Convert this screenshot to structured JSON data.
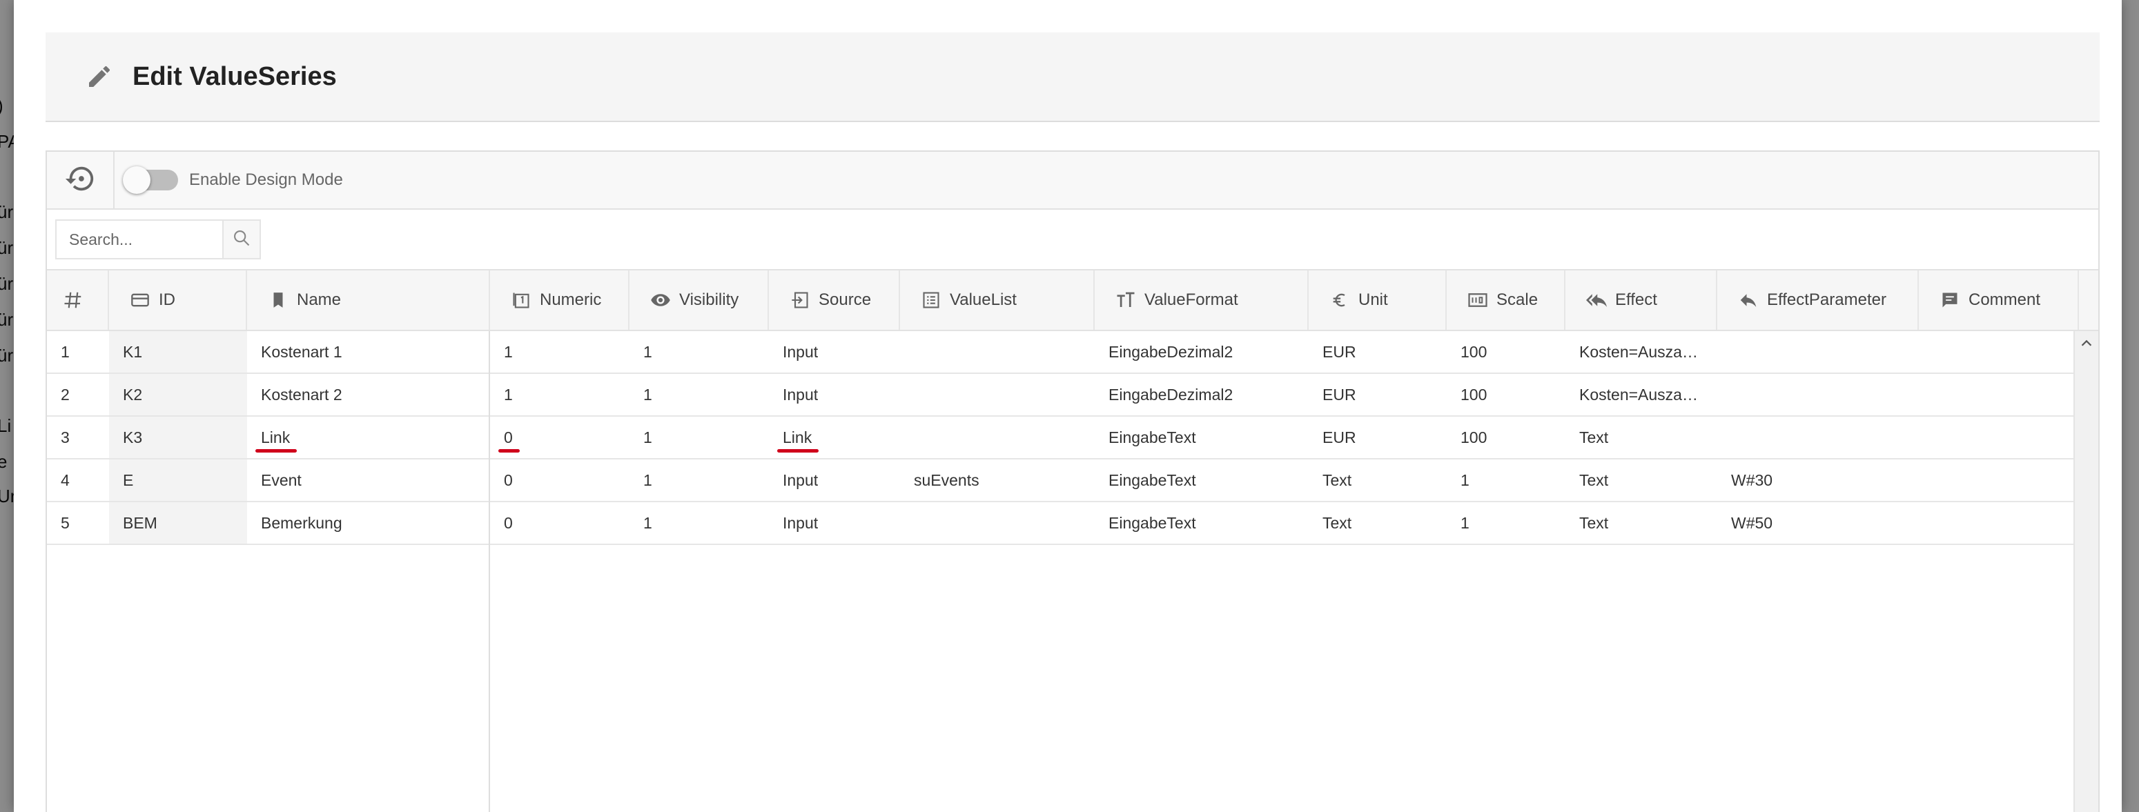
{
  "background_fragments": [
    ")",
    "PA",
    "ür",
    "ür",
    "ür",
    "ür",
    "ür",
    "Li",
    "e",
    "Ur"
  ],
  "modal": {
    "title": "Edit ValueSeries"
  },
  "toolbar": {
    "design_mode_label": "Enable Design Mode",
    "design_mode_enabled": false
  },
  "search": {
    "placeholder": "Search..."
  },
  "table": {
    "columns": [
      {
        "key": "num",
        "label": "#",
        "icon": "hash-icon"
      },
      {
        "key": "id",
        "label": "ID",
        "icon": "card-icon"
      },
      {
        "key": "name",
        "label": "Name",
        "icon": "bookmark-icon"
      },
      {
        "key": "numeric",
        "label": "Numeric",
        "icon": "numeric-box-icon"
      },
      {
        "key": "visibility",
        "label": "Visibility",
        "icon": "eye-icon"
      },
      {
        "key": "source",
        "label": "Source",
        "icon": "login-icon"
      },
      {
        "key": "valuelist",
        "label": "ValueList",
        "icon": "list-icon"
      },
      {
        "key": "valueformat",
        "label": "ValueFormat",
        "icon": "text-size-icon"
      },
      {
        "key": "unit",
        "label": "Unit",
        "icon": "euro-icon"
      },
      {
        "key": "scale",
        "label": "Scale",
        "icon": "counter-icon"
      },
      {
        "key": "effect",
        "label": "Effect",
        "icon": "reply-all-icon"
      },
      {
        "key": "effectparameter",
        "label": "EffectParameter",
        "icon": "reply-icon"
      },
      {
        "key": "comment",
        "label": "Comment",
        "icon": "comment-icon"
      }
    ],
    "rows": [
      {
        "num": "1",
        "id": "K1",
        "name": "Kostenart 1",
        "numeric": "1",
        "visibility": "1",
        "source": "Input",
        "valuelist": "",
        "valueformat": "EingabeDezimal2",
        "unit": "EUR",
        "scale": "100",
        "effect": "Kosten=Ausza…",
        "effectparameter": "",
        "comment": ""
      },
      {
        "num": "2",
        "id": "K2",
        "name": "Kostenart 2",
        "numeric": "1",
        "visibility": "1",
        "source": "Input",
        "valuelist": "",
        "valueformat": "EingabeDezimal2",
        "unit": "EUR",
        "scale": "100",
        "effect": "Kosten=Ausza…",
        "effectparameter": "",
        "comment": ""
      },
      {
        "num": "3",
        "id": "K3",
        "name": "Link",
        "numeric": "0",
        "visibility": "1",
        "source": "Link",
        "valuelist": "",
        "valueformat": "EingabeText",
        "unit": "EUR",
        "scale": "100",
        "effect": "Text",
        "effectparameter": "",
        "comment": ""
      },
      {
        "num": "4",
        "id": "E",
        "name": "Event",
        "numeric": "0",
        "visibility": "1",
        "source": "Input",
        "valuelist": "suEvents",
        "valueformat": "EingabeText",
        "unit": "Text",
        "scale": "1",
        "effect": "Text",
        "effectparameter": "W#30",
        "comment": ""
      },
      {
        "num": "5",
        "id": "BEM",
        "name": "Bemerkung",
        "numeric": "0",
        "visibility": "1",
        "source": "Input",
        "valuelist": "",
        "valueformat": "EingabeText",
        "unit": "Text",
        "scale": "1",
        "effect": "Text",
        "effectparameter": "W#50",
        "comment": ""
      }
    ]
  },
  "colors": {
    "annotation_underline": "#d0021b"
  }
}
